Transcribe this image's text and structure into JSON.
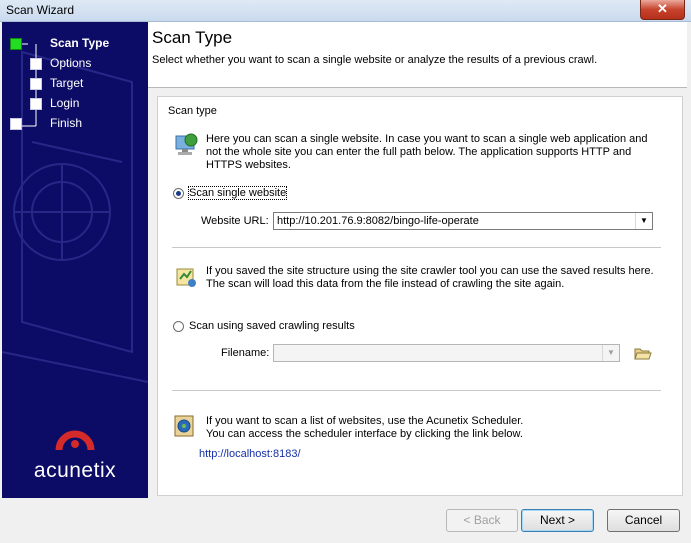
{
  "window": {
    "title": "Scan Wizard",
    "close_glyph": "✕"
  },
  "sidebar": {
    "steps": [
      {
        "label": "Scan Type",
        "active": true
      },
      {
        "label": "Options",
        "active": false
      },
      {
        "label": "Target",
        "active": false
      },
      {
        "label": "Login",
        "active": false
      },
      {
        "label": "Finish",
        "active": false
      }
    ],
    "logo_text": "acunetix",
    "logo_icon": "acunetix-logo-icon"
  },
  "header": {
    "title": "Scan Type",
    "subtitle": "Select whether you want to scan a single website or analyze the results of a previous crawl."
  },
  "group": {
    "label": "Scan type",
    "single": {
      "icon": "computer-globe-icon",
      "description": [
        "Here you can scan a single website. In case you want to scan a single web application and",
        "not the whole site you can enter the full path below. The application supports HTTP and",
        "HTTPS websites."
      ],
      "radio_label": "Scan single website",
      "selected": true,
      "url_label": "Website URL:",
      "url_value": "http://10.201.76.9:8082/bingo-life-operate"
    },
    "crawl": {
      "icon": "crawler-results-icon",
      "description": [
        "If you saved the site structure using the site crawler tool you can use the saved results here.",
        "The scan will load this data from the file instead of crawling the site again."
      ],
      "radio_label": "Scan using saved crawling results",
      "selected": false,
      "filename_label": "Filename:",
      "filename_value": "",
      "browse_icon": "folder-open-icon"
    },
    "scheduler": {
      "icon": "scheduler-icon",
      "description": [
        "If you want to scan a list of websites, use the Acunetix Scheduler.",
        "You can access the scheduler interface by clicking the link below."
      ],
      "link": "http://localhost:8183/"
    }
  },
  "buttons": {
    "back": "< Back",
    "next": "Next >",
    "cancel": "Cancel"
  },
  "colors": {
    "sidebar_bg": "#0c0c66",
    "active_step": "#22dd22",
    "logo_red": "#d42a2a",
    "link": "#1530a8"
  }
}
